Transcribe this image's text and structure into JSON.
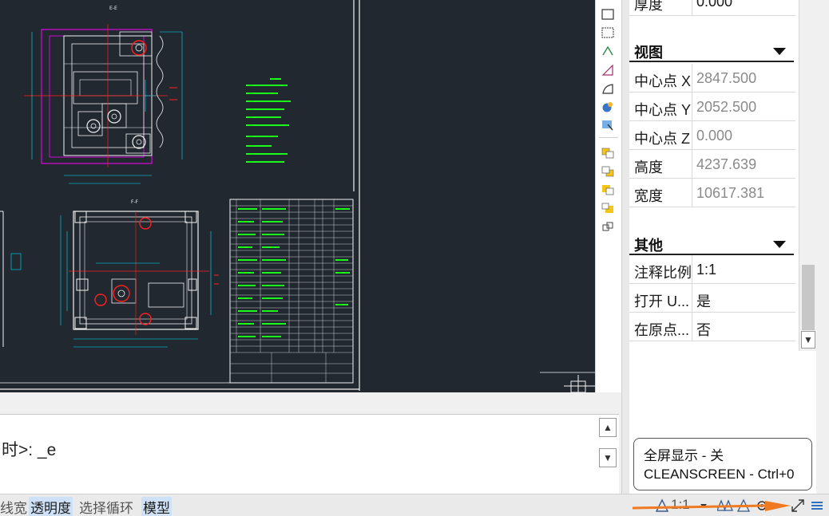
{
  "properties": {
    "top_row": {
      "label": "厚度",
      "value": "0.000"
    },
    "view_section": {
      "title": "视图",
      "rows": [
        {
          "label": "中心点 X",
          "value": "2847.500"
        },
        {
          "label": "中心点 Y",
          "value": "2052.500"
        },
        {
          "label": "中心点 Z",
          "value": "0.000"
        },
        {
          "label": "高度",
          "value": "4237.639"
        },
        {
          "label": "宽度",
          "value": "10617.381"
        }
      ]
    },
    "other_section": {
      "title": "其他",
      "rows": [
        {
          "label": "注释比例",
          "value": "1:1"
        },
        {
          "label": "打开 U...",
          "value": "是"
        },
        {
          "label": "在原点...",
          "value": "否"
        }
      ]
    }
  },
  "command": {
    "prompt_text": "时>: _e"
  },
  "status_bar": {
    "items": [
      {
        "label": "线宽",
        "active": false
      },
      {
        "label": "透明度",
        "active": true
      },
      {
        "label": "选择循环",
        "active": false
      },
      {
        "label": "模型",
        "active": true
      }
    ],
    "scale": "1:1"
  },
  "tooltip": {
    "line1": "全屏显示 - 关",
    "line2": "CLEANSCREEN - Ctrl+0"
  },
  "drawing": {
    "view_label_1": "E-E",
    "view_label_2": "F-F"
  },
  "colors": {
    "canvas_bg": "#212830",
    "cad_cyan": "#00e5ff",
    "cad_green": "#19ff19",
    "cad_magenta": "#ff00ff",
    "cad_red": "#ff2020",
    "cad_white": "#f2f2f2",
    "arrow_orange": "#f07a22"
  }
}
